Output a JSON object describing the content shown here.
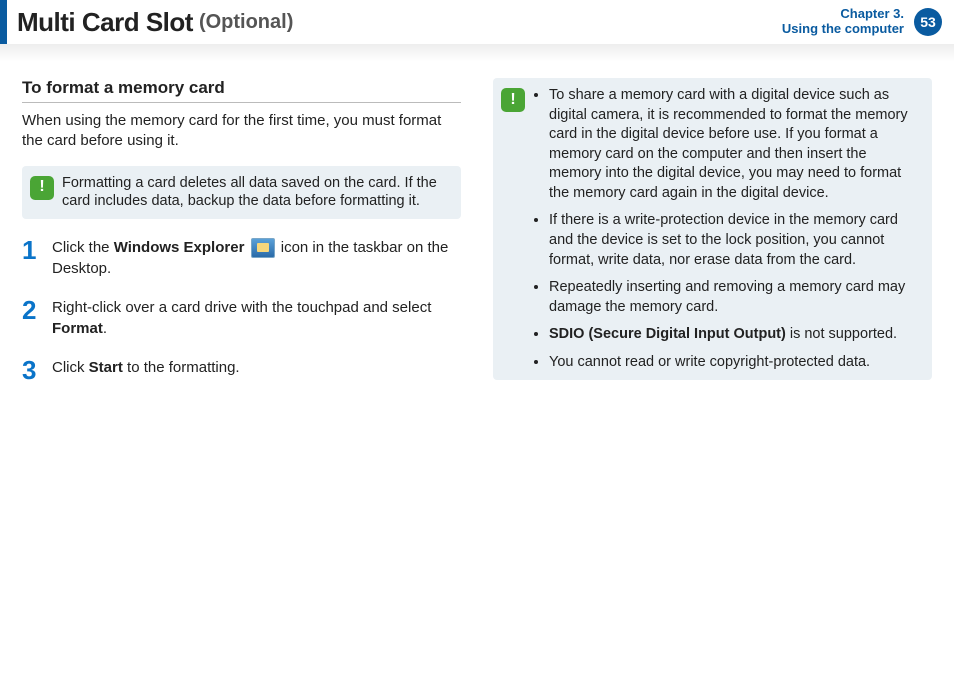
{
  "header": {
    "title_main": "Multi Card Slot",
    "title_sub": "(Optional)",
    "chapter_line1": "Chapter 3.",
    "chapter_line2": "Using the computer",
    "page_number": "53"
  },
  "left": {
    "section_title": "To format a memory card",
    "intro": "When using the memory card for the first time, you must format the card before using it.",
    "warning": "Formatting a card deletes all data saved on the card. If the card includes data, backup the data before formatting it.",
    "steps": {
      "s1_a": "Click the ",
      "s1_b": "Windows Explorer",
      "s1_c": " icon in the taskbar on the Desktop.",
      "s2_a": "Right-click over a card drive with the touchpad and select ",
      "s2_b": "Format",
      "s2_c": ".",
      "s3_a": "Click ",
      "s3_b": "Start",
      "s3_c": " to the formatting."
    },
    "nums": {
      "n1": "1",
      "n2": "2",
      "n3": "3"
    }
  },
  "right": {
    "items": {
      "i1": "To share a memory card with a digital device such as digital camera, it is recommended to format the memory card in the digital device before use. If you format a memory card on the computer and then insert the memory into the digital device, you may need to format the memory card again in the digital device.",
      "i2": "If there is a write-protection device in the memory card and the device is set to the lock position, you cannot format, write data, nor erase data from the card.",
      "i3": "Repeatedly inserting and removing a memory card may damage the memory card.",
      "i4_b": "SDIO (Secure Digital Input Output)",
      "i4_rest": " is not supported.",
      "i5": "You cannot read or write copyright-protected data."
    }
  }
}
